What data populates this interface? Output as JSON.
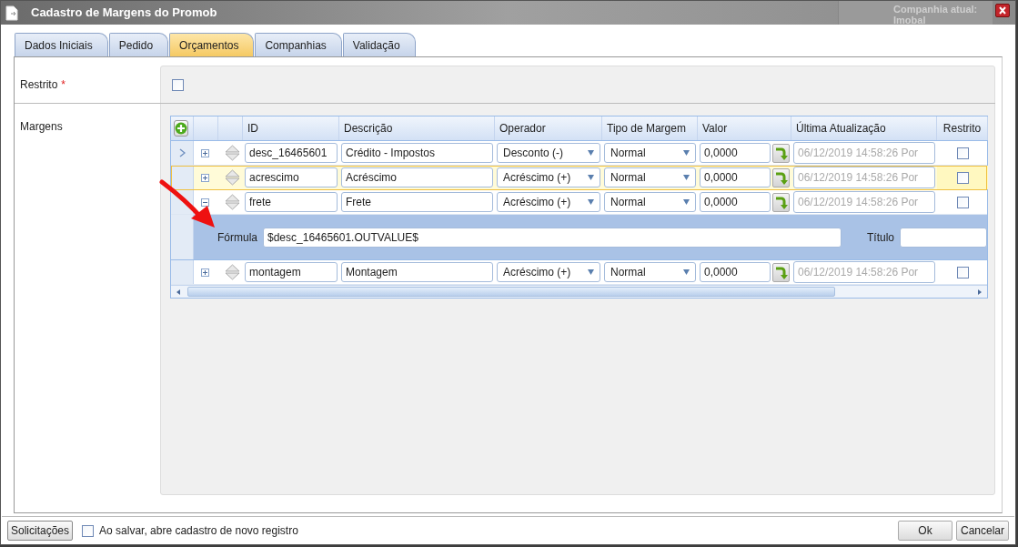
{
  "background_window": {
    "texts": [
      "Companhia atual:",
      "Imobal"
    ]
  },
  "window": {
    "title": "Cadastro de Margens do Promob"
  },
  "tabs": [
    {
      "label": "Dados Iniciais",
      "selected": false
    },
    {
      "label": "Pedido",
      "selected": false
    },
    {
      "label": "Orçamentos",
      "selected": true
    },
    {
      "label": "Companhias",
      "selected": false
    },
    {
      "label": "Validação",
      "selected": false
    }
  ],
  "form": {
    "restricted_label": "Restrito",
    "required_mark": "*",
    "restricted_checked": false,
    "margins_label": "Margens"
  },
  "table": {
    "columns": [
      "ID",
      "Descrição",
      "Operador",
      "Tipo de Margem",
      "Valor",
      "Última Atualização",
      "Restrito"
    ],
    "rows": [
      {
        "id": "desc_16465601",
        "description": "Crédito - Impostos",
        "operator": "Desconto (-)",
        "margin_type": "Normal",
        "value": "0,0000",
        "updated": "06/12/2019 14:58:26 Por",
        "restricted": false,
        "current": true,
        "selected": false,
        "expanded": false
      },
      {
        "id": "acrescimo",
        "description": "Acréscimo",
        "operator": "Acréscimo (+)",
        "margin_type": "Normal",
        "value": "0,0000",
        "updated": "06/12/2019 14:58:26 Por",
        "restricted": false,
        "current": false,
        "selected": true,
        "expanded": false
      },
      {
        "id": "frete",
        "description": "Frete",
        "operator": "Acréscimo (+)",
        "margin_type": "Normal",
        "value": "0,0000",
        "updated": "06/12/2019 14:58:26 Por",
        "restricted": false,
        "current": false,
        "selected": false,
        "expanded": true,
        "detail": {
          "formula_label": "Fórmula",
          "formula": "$desc_16465601.OUTVALUE$",
          "title_label": "Título"
        }
      },
      {
        "id": "montagem",
        "description": "Montagem",
        "operator": "Acréscimo (+)",
        "margin_type": "Normal",
        "value": "0,0000",
        "updated": "06/12/2019 14:58:26 Por",
        "restricted": false,
        "current": false,
        "selected": false,
        "expanded": false
      }
    ]
  },
  "footer": {
    "requests_button": "Solicitações",
    "open_new_checked": false,
    "open_new_label": "Ao salvar, abre cadastro de novo registro",
    "buttons": [
      "Ok",
      "Cancelar"
    ]
  }
}
